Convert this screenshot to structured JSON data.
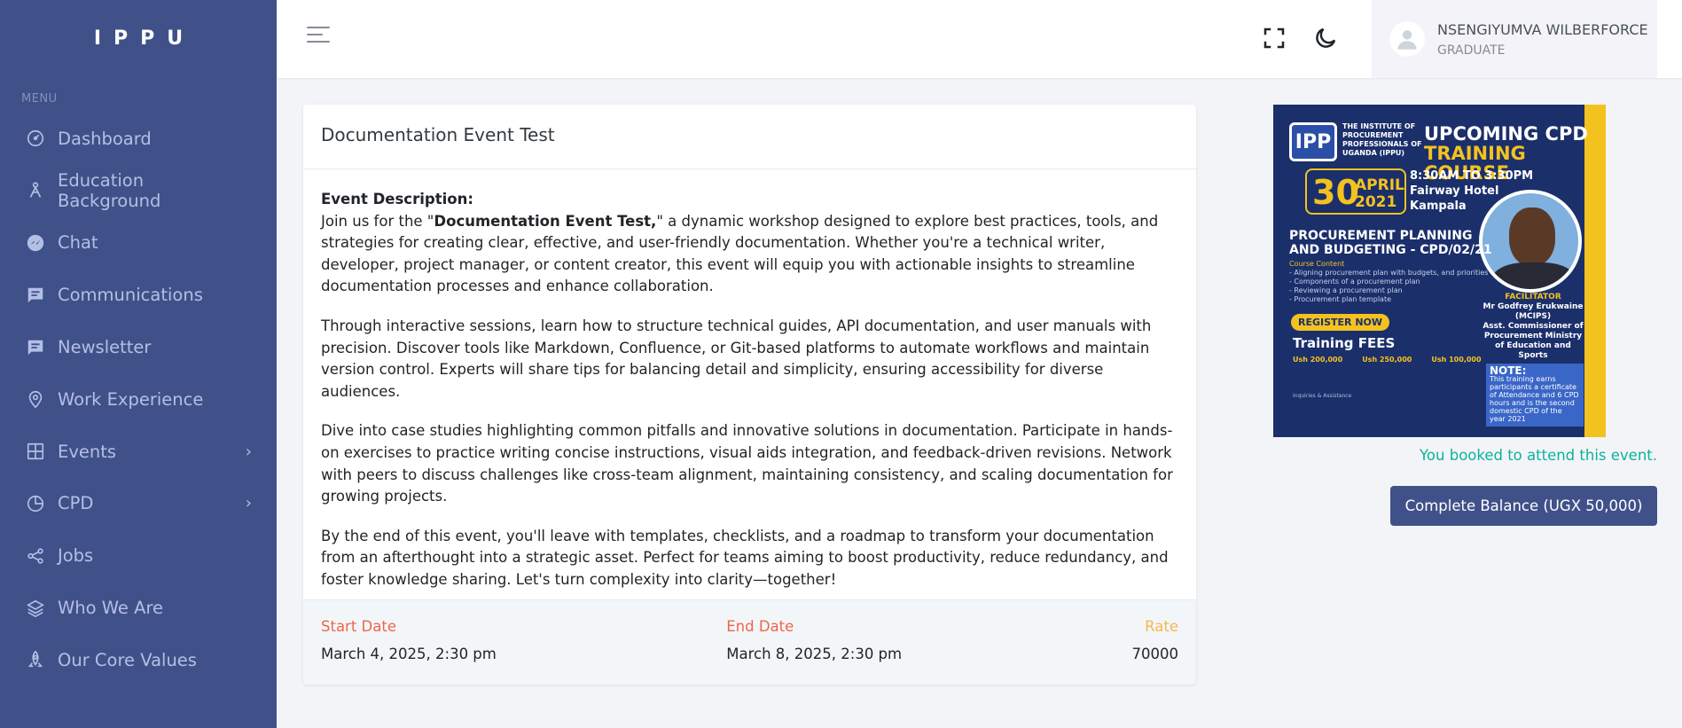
{
  "brand": "IPPU",
  "sidebar": {
    "menu_title": "MENU",
    "items": [
      {
        "label": "Dashboard",
        "icon": "dashboard-icon"
      },
      {
        "label": "Education Background",
        "icon": "education-icon"
      },
      {
        "label": "Chat",
        "icon": "chat-icon"
      },
      {
        "label": "Communications",
        "icon": "message-icon"
      },
      {
        "label": "Newsletter",
        "icon": "message-icon"
      },
      {
        "label": "Work Experience",
        "icon": "location-pin-icon"
      },
      {
        "label": "Events",
        "icon": "grid-icon",
        "has_submenu": true
      },
      {
        "label": "CPD",
        "icon": "pie-chart-icon",
        "has_submenu": true
      },
      {
        "label": "Jobs",
        "icon": "share-icon"
      },
      {
        "label": "Who We Are",
        "icon": "layers-icon"
      },
      {
        "label": "Our Core Values",
        "icon": "rocket-icon"
      }
    ]
  },
  "user": {
    "name": "NSENGIYUMVA WILBERFORCE",
    "role": "GRADUATE"
  },
  "event": {
    "title": "Documentation Event Test",
    "description_label": "Event Description:",
    "intro_pre": "Join us for the \"",
    "intro_bold": "Documentation Event Test,",
    "intro_post": "\" a dynamic workshop designed to explore best practices, tools, and strategies for creating clear, effective, and user-friendly documentation. Whether you're a technical writer, developer, project manager, or content creator, this event will equip you with actionable insights to streamline documentation processes and enhance collaboration.",
    "paragraphs": [
      "Through interactive sessions, learn how to structure technical guides, API documentation, and user manuals with precision. Discover tools like Markdown, Confluence, or Git-based platforms to automate workflows and maintain version control. Experts will share tips for balancing detail and simplicity, ensuring accessibility for diverse audiences.",
      "Dive into case studies highlighting common pitfalls and innovative solutions in documentation. Participate in hands-on exercises to practice writing concise instructions, visual aids integration, and feedback-driven revisions. Network with peers to discuss challenges like cross-team alignment, maintaining consistency, and scaling documentation for growing projects.",
      "By the end of this event, you'll leave with templates, checklists, and a roadmap to transform your documentation from an afterthought into a strategic asset. Perfect for teams aiming to boost productivity, reduce redundancy, and foster knowledge sharing. Let's turn complexity into clarity—together!"
    ],
    "start_label": "Start Date",
    "start_value": "March 4, 2025, 2:30 pm",
    "end_label": "End Date",
    "end_value": "March 8, 2025, 2:30 pm",
    "rate_label": "Rate",
    "rate_value": "70000"
  },
  "poster": {
    "logo_text": "IPP",
    "institute": "THE INSTITUTE OF PROCUREMENT PROFESSIONALS OF UGANDA (IPPU)",
    "upcoming": "UPCOMING CPD",
    "training": "TRAINING COURSE",
    "day": "30",
    "month_year": "APRIL 2021",
    "time": "8:30AM TO 3:30PM",
    "venue1": "Fairway Hotel",
    "venue2": "Kampala",
    "course1": "PROCUREMENT PLANNING",
    "course2": "AND BUDGETING - CPD/02/21",
    "contents_title": "Course Content",
    "contents": [
      "- Aligning procurement plan with budgets, and priorities",
      "- Components of a procurement plan",
      "- Reviewing a procurement plan",
      "- Procurement plan template"
    ],
    "facilitator_title": "FACILITATOR",
    "facilitator_name": "Mr Godfrey Erukwaine (MCIPS)",
    "facilitator_role": "Asst. Commissioner of Procurement Ministry of Education and Sports",
    "register": "REGISTER NOW",
    "fees_title": "Training FEES",
    "fees": [
      "Ush 200,000",
      "Ush 250,000",
      "Ush 100,000"
    ],
    "note_title": "NOTE:",
    "note_text": "This training earns participants a certificate of Attendance and 6 CPD hours and is the second domestic CPD of the year 2021",
    "inquiries": "Inquiries & Assistance"
  },
  "booked_text": "You booked to attend this event.",
  "balance_button": "Complete Balance (UGX 50,000)",
  "colors": {
    "sidebar_bg": "#405189",
    "accent": "#405189",
    "success": "#0ab39c",
    "danger": "#f06548",
    "warning": "#f7b84b"
  }
}
